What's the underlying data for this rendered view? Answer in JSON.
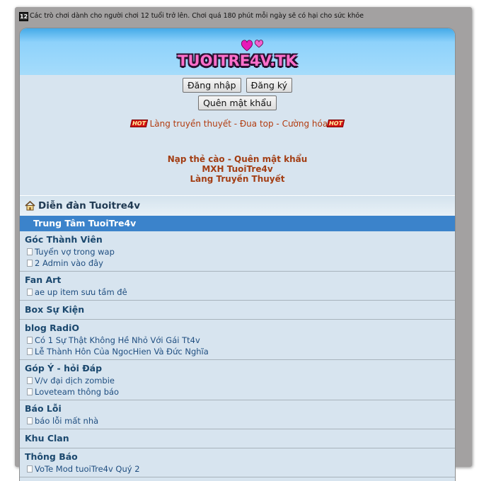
{
  "notice": {
    "badge": "12",
    "text": "Các trò chơi dành cho người chơi 12 tuổi trở lên. Chơi quá 180 phút mỗi ngày sẽ có hại cho sức khỏe"
  },
  "header": {
    "logo_text": "TUOITRE4V.TK"
  },
  "auth": {
    "login_label": "Đăng nhập",
    "register_label": "Đăng ký",
    "forgot_label": "Quên mật khẩu"
  },
  "promo": {
    "hot_label": "HOT",
    "text": "Làng truyền thuyết - Đua top - Cường hóa"
  },
  "links": {
    "line1": "Nạp thẻ cào - Quên mật khẩu",
    "line2": "MXH TuoiTre4v",
    "line3": "Làng Truyền Thuyết"
  },
  "forum_section": {
    "title": "Diễn đàn Tuoitre4v",
    "category": "Trung Tâm TuoiTre4v"
  },
  "forums": [
    {
      "title": "Góc Thành Viên",
      "topics": [
        "Tuyển vợ trong wap",
        "2 Admin vào đây"
      ]
    },
    {
      "title": "Fan Art",
      "topics": [
        "ae up item sưu tầm đê"
      ]
    },
    {
      "title": "Box Sự Kiện",
      "topics": []
    },
    {
      "title": "blog RadiO",
      "topics": [
        "Có 1 Sự Thật Không Hề Nhỏ Với Gái Tt4v",
        "Lễ Thành Hôn Của NgocHien Và Đức Nghĩa"
      ]
    },
    {
      "title": "Góp Ý - hỏi Đáp",
      "topics": [
        "V/v đại dịch zombie",
        "Loveteam thông báo"
      ]
    },
    {
      "title": "Báo Lỗi",
      "topics": [
        "báo lỗi mất nhà"
      ]
    },
    {
      "title": "Khu Clan",
      "topics": []
    },
    {
      "title": "Thông Báo",
      "topics": [
        "VoTe Mod tuoiTre4v Quý 2"
      ]
    }
  ],
  "colors": {
    "banner": "#8ed2fb",
    "body_bg": "#d7e4ef",
    "category_bar": "#3b83cb",
    "link_red": "#a33e14",
    "forum_title": "#1b486e"
  }
}
